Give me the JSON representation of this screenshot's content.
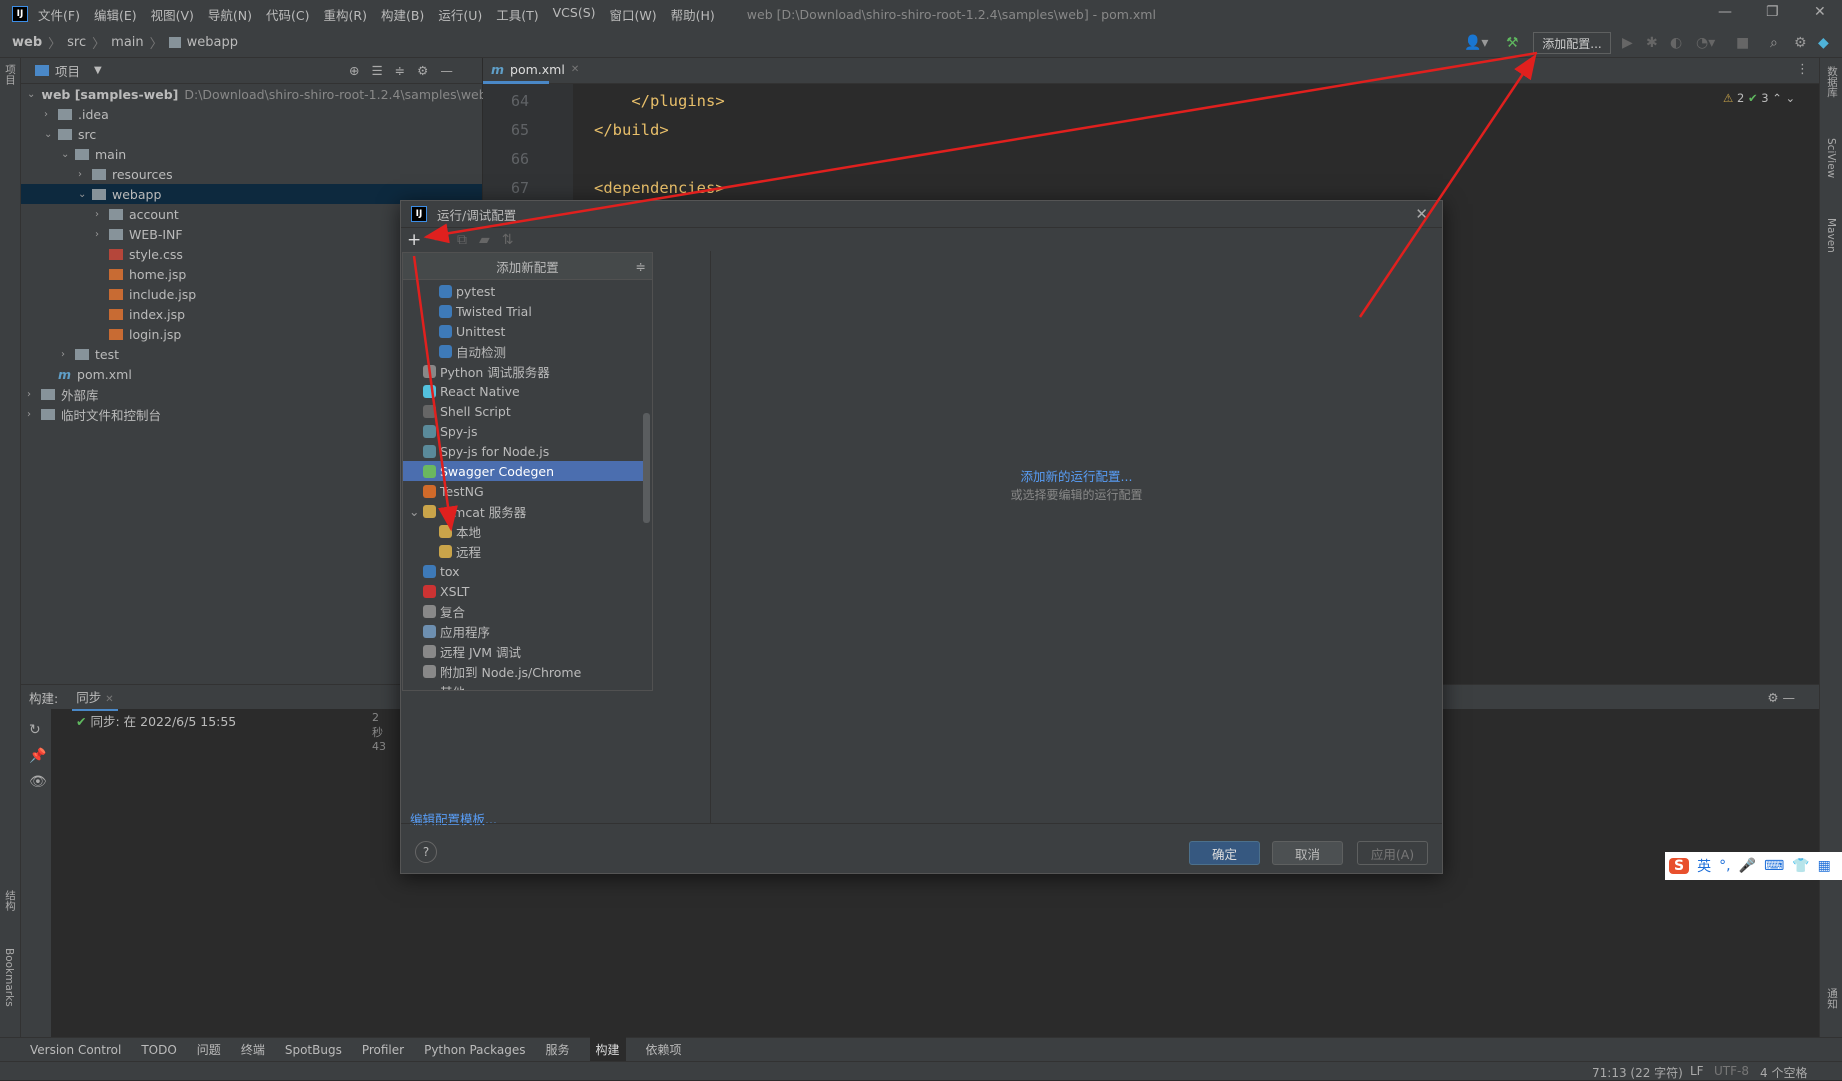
{
  "menubar": {
    "items": [
      "文件(F)",
      "编辑(E)",
      "视图(V)",
      "导航(N)",
      "代码(C)",
      "重构(R)",
      "构建(B)",
      "运行(U)",
      "工具(T)",
      "VCS(S)",
      "窗口(W)",
      "帮助(H)"
    ],
    "window_title": "web [D:\\Download\\shiro-shiro-root-1.2.4\\samples\\web] - pom.xml"
  },
  "breadcrumb": [
    "web",
    "src",
    "main",
    "webapp"
  ],
  "toolbar": {
    "add_config": "添加配置..."
  },
  "left_strip": {
    "project": "项目",
    "structure": "结构",
    "bookmarks": "Bookmarks"
  },
  "right_strip": {
    "database": "数据库",
    "sciview": "SciView",
    "maven": "Maven",
    "notifications": "通知"
  },
  "project": {
    "title": "项目",
    "tree": [
      {
        "label": "web [samples-web]",
        "hint": "D:\\Download\\shiro-shiro-root-1.2.4\\samples\\web",
        "indent": 0,
        "exp": "v",
        "icon": "module"
      },
      {
        "label": ".idea",
        "indent": 1,
        "exp": ">",
        "icon": "folder"
      },
      {
        "label": "src",
        "indent": 1,
        "exp": "v",
        "icon": "folder"
      },
      {
        "label": "main",
        "indent": 2,
        "exp": "v",
        "icon": "folder"
      },
      {
        "label": "resources",
        "indent": 3,
        "exp": ">",
        "icon": "folder"
      },
      {
        "label": "webapp",
        "indent": 3,
        "exp": "v",
        "icon": "folder",
        "selected": true
      },
      {
        "label": "account",
        "indent": 4,
        "exp": ">",
        "icon": "folder"
      },
      {
        "label": "WEB-INF",
        "indent": 4,
        "exp": ">",
        "icon": "folder"
      },
      {
        "label": "style.css",
        "indent": 4,
        "icon": "css"
      },
      {
        "label": "home.jsp",
        "indent": 4,
        "icon": "jsp"
      },
      {
        "label": "include.jsp",
        "indent": 4,
        "icon": "jsp"
      },
      {
        "label": "index.jsp",
        "indent": 4,
        "icon": "jsp"
      },
      {
        "label": "login.jsp",
        "indent": 4,
        "icon": "jsp"
      },
      {
        "label": "test",
        "indent": 2,
        "exp": ">",
        "icon": "folder"
      },
      {
        "label": "pom.xml",
        "indent": 1,
        "icon": "maven"
      },
      {
        "label": "外部库",
        "indent": 0,
        "exp": ">",
        "icon": "library"
      },
      {
        "label": "临时文件和控制台",
        "indent": 0,
        "exp": ">",
        "icon": "scratch"
      }
    ]
  },
  "editor": {
    "tab": "pom.xml",
    "inspections": {
      "warnings": "2",
      "ok": "3"
    },
    "lines": [
      {
        "n": "64",
        "code": "    </plugins>"
      },
      {
        "n": "65",
        "code": "</build>"
      },
      {
        "n": "66",
        "code": ""
      },
      {
        "n": "67",
        "code": "<dependencies>"
      }
    ]
  },
  "build": {
    "label": "构建:",
    "tab": "同步",
    "row": "同步: 在 2022/6/5 15:55",
    "time": "2秒43"
  },
  "dialog": {
    "title": "运行/调试配置",
    "popup_title": "添加新配置",
    "items": [
      {
        "label": "pytest",
        "indent": 1,
        "icon": "python"
      },
      {
        "label": "Twisted Trial",
        "indent": 1,
        "icon": "python"
      },
      {
        "label": "Unittest",
        "indent": 1,
        "icon": "python"
      },
      {
        "label": "自动检测",
        "indent": 1,
        "icon": "python"
      },
      {
        "label": "Python 调试服务器",
        "indent": 0,
        "icon": "remote"
      },
      {
        "label": "React Native",
        "indent": 0,
        "icon": "react"
      },
      {
        "label": "Shell Script",
        "indent": 0,
        "icon": "shell"
      },
      {
        "label": "Spy-js",
        "indent": 0,
        "icon": "spy"
      },
      {
        "label": "Spy-js for Node.js",
        "indent": 0,
        "icon": "spy"
      },
      {
        "label": "Swagger Codegen",
        "indent": 0,
        "icon": "swagger",
        "selected": true
      },
      {
        "label": "TestNG",
        "indent": 0,
        "icon": "testng"
      },
      {
        "label": "Tomcat 服务器",
        "indent": 0,
        "icon": "tomcat",
        "exp": "v"
      },
      {
        "label": "本地",
        "indent": 1,
        "icon": "tomcat"
      },
      {
        "label": "远程",
        "indent": 1,
        "icon": "tomcat"
      },
      {
        "label": "tox",
        "indent": 0,
        "icon": "python"
      },
      {
        "label": "XSLT",
        "indent": 0,
        "icon": "xslt"
      },
      {
        "label": "复合",
        "indent": 0,
        "icon": "compound"
      },
      {
        "label": "应用程序",
        "indent": 0,
        "icon": "app"
      },
      {
        "label": "远程 JVM 调试",
        "indent": 0,
        "icon": "remote"
      },
      {
        "label": "附加到 Node.js/Chrome",
        "indent": 0,
        "icon": "node"
      },
      {
        "label": "其他",
        "indent": 0,
        "icon": "none",
        "exp": "v"
      }
    ],
    "empty_link": "添加新的运行配置...",
    "empty_hint": "或选择要编辑的运行配置",
    "edit_templates": "编辑配置模板...",
    "ok": "确定",
    "cancel": "取消",
    "apply": "应用(A)",
    "help": "?"
  },
  "bottom_tools": [
    "Version Control",
    "TODO",
    "问题",
    "终端",
    "SpotBugs",
    "Profiler",
    "Python Packages",
    "服务",
    "构建",
    "依赖项"
  ],
  "status": {
    "position": "71:13 (22 字符)",
    "line_sep": "LF",
    "encoding": "UTF-8",
    "indent": "4 个空格"
  },
  "ime": {
    "lang": "英"
  },
  "colors": {
    "selection": "#4b6eaf",
    "link": "#589df6",
    "arrow": "#e0201e",
    "primary_button": "#365880"
  }
}
